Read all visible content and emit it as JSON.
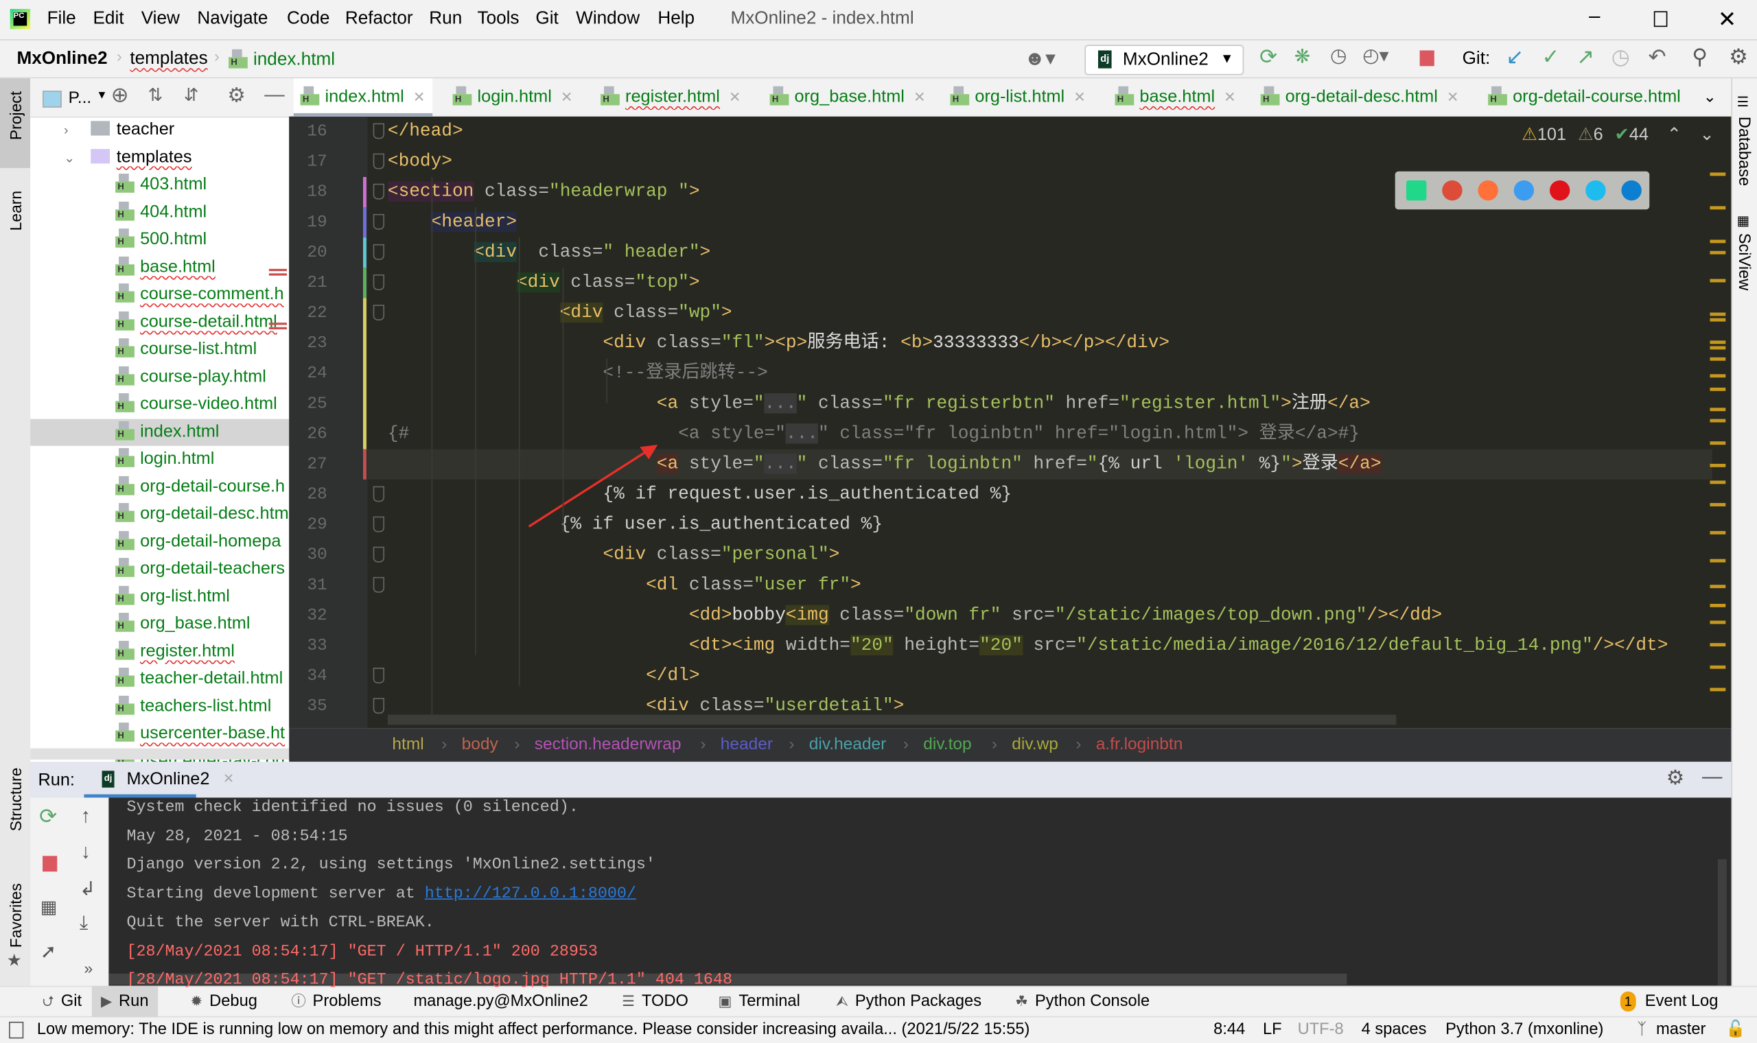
{
  "window": {
    "title": "MxOnline2 - index.html",
    "menu": [
      "File",
      "Edit",
      "View",
      "Navigate",
      "Code",
      "Refactor",
      "Run",
      "Tools",
      "Git",
      "Window",
      "Help"
    ],
    "controls": [
      "minimize",
      "restore",
      "close"
    ]
  },
  "navbar": {
    "breadcrumb": [
      "MxOnline2",
      "templates",
      "index.html"
    ],
    "run_config": "MxOnline2",
    "git_label": "Git:",
    "colors": {
      "stop": "#db5860",
      "run": "#59a869",
      "git_update": "#3592c4"
    }
  },
  "project_panel": {
    "title": "P...",
    "tree": [
      {
        "label": "teacher",
        "type": "folder",
        "expanded": false
      },
      {
        "label": "templates",
        "type": "folder",
        "expanded": true,
        "error": true
      },
      {
        "label": "403.html",
        "type": "file"
      },
      {
        "label": "404.html",
        "type": "file"
      },
      {
        "label": "500.html",
        "type": "file"
      },
      {
        "label": "base.html",
        "type": "file",
        "error": true
      },
      {
        "label": "course-comment.h",
        "type": "file",
        "error": true
      },
      {
        "label": "course-detail.html",
        "type": "file",
        "error": true
      },
      {
        "label": "course-list.html",
        "type": "file"
      },
      {
        "label": "course-play.html",
        "type": "file"
      },
      {
        "label": "course-video.html",
        "type": "file"
      },
      {
        "label": "index.html",
        "type": "file",
        "selected": true
      },
      {
        "label": "login.html",
        "type": "file"
      },
      {
        "label": "org-detail-course.h",
        "type": "file"
      },
      {
        "label": "org-detail-desc.htm",
        "type": "file"
      },
      {
        "label": "org-detail-homepa",
        "type": "file"
      },
      {
        "label": "org-detail-teachers",
        "type": "file"
      },
      {
        "label": "org-list.html",
        "type": "file"
      },
      {
        "label": "org_base.html",
        "type": "file"
      },
      {
        "label": "register.html",
        "type": "file",
        "error": true
      },
      {
        "label": "teacher-detail.html",
        "type": "file"
      },
      {
        "label": "teachers-list.html",
        "type": "file"
      },
      {
        "label": "usercenter-base.ht",
        "type": "file",
        "error": true
      },
      {
        "label": "usercenter-fav-cou",
        "type": "file"
      }
    ]
  },
  "side_left": [
    "Project",
    "Learn",
    "Structure",
    "Favorites"
  ],
  "side_right": [
    "Database",
    "SciView"
  ],
  "editor_tabs": [
    {
      "label": "index.html",
      "active": true
    },
    {
      "label": "login.html"
    },
    {
      "label": "register.html",
      "error": true
    },
    {
      "label": "org_base.html"
    },
    {
      "label": "org-list.html"
    },
    {
      "label": "base.html",
      "error": true
    },
    {
      "label": "org-detail-desc.html"
    },
    {
      "label": "org-detail-course.html"
    }
  ],
  "inspections": {
    "warnings": "101",
    "weak_warnings": "6",
    "typos": "44"
  },
  "browsers": [
    "pycharm",
    "chrome",
    "firefox",
    "safari",
    "opera",
    "internet-explorer",
    "edge"
  ],
  "code": [
    {
      "n": "16",
      "tokens": [
        [
          "</head>",
          "tag"
        ]
      ]
    },
    {
      "n": "17",
      "tokens": [
        [
          "<body>",
          "tag"
        ]
      ]
    },
    {
      "n": "18",
      "tokens": [
        [
          "<section",
          "tag",
          "#3c2438"
        ],
        [
          " class=",
          "attr"
        ],
        [
          "\"headerwrap \"",
          "val"
        ],
        [
          ">",
          "tag"
        ]
      ]
    },
    {
      "n": "19",
      "tokens": [
        [
          "    ",
          "txt"
        ],
        [
          "<header>",
          "tag",
          "#262a40"
        ]
      ]
    },
    {
      "n": "20",
      "tokens": [
        [
          "        ",
          "txt"
        ],
        [
          "<div",
          "tag",
          "#1f3b35"
        ],
        [
          "  class=",
          "attr"
        ],
        [
          "\" header\"",
          "val"
        ],
        [
          ">",
          "tag"
        ]
      ]
    },
    {
      "n": "21",
      "tokens": [
        [
          "            ",
          "txt"
        ],
        [
          "<div",
          "tag",
          "#1f3a1f"
        ],
        [
          " class=",
          "attr"
        ],
        [
          "\"top\"",
          "val"
        ],
        [
          ">",
          "tag"
        ]
      ]
    },
    {
      "n": "22",
      "tokens": [
        [
          "                ",
          "txt"
        ],
        [
          "<div",
          "tag",
          "#3a3a1c"
        ],
        [
          " class=",
          "attr"
        ],
        [
          "\"wp\"",
          "val"
        ],
        [
          ">",
          "tag"
        ]
      ]
    },
    {
      "n": "23",
      "tokens": [
        [
          "                    ",
          "txt"
        ],
        [
          "<div",
          "tag"
        ],
        [
          " class=",
          "attr"
        ],
        [
          "\"fl\"",
          "val"
        ],
        [
          "><p>",
          "tag"
        ],
        [
          "服务电话: ",
          "txt"
        ],
        [
          "<b>",
          "tag"
        ],
        [
          "33333333",
          "txt"
        ],
        [
          "</b></p></div>",
          "tag"
        ]
      ]
    },
    {
      "n": "24",
      "tokens": [
        [
          "                    ",
          "txt"
        ],
        [
          "<!--登录后跳转-->",
          "cmt"
        ]
      ]
    },
    {
      "n": "25",
      "tokens": [
        [
          "                         ",
          "txt"
        ],
        [
          "<a",
          "tag"
        ],
        [
          " style=",
          "attr"
        ],
        [
          "\"",
          "val"
        ],
        [
          "...",
          "cmt",
          "#3a3a3a"
        ],
        [
          "\"",
          "val"
        ],
        [
          " class=",
          "attr"
        ],
        [
          "\"fr registerbtn\"",
          "val"
        ],
        [
          " href=",
          "attr"
        ],
        [
          "\"register.html\"",
          "val"
        ],
        [
          ">",
          "tag"
        ],
        [
          "注册",
          "txt"
        ],
        [
          "</a>",
          "tag"
        ]
      ]
    },
    {
      "n": "26",
      "tokens": [
        [
          "{#                         <a style=\"",
          "cmt"
        ],
        [
          "...",
          "cmt",
          "#3a3a3a"
        ],
        [
          "\" class=\"fr loginbtn\" href=\"login.html\"> 登录</a>#}",
          "cmt"
        ]
      ]
    },
    {
      "n": "27",
      "current": true,
      "tokens": [
        [
          "                         ",
          "txt"
        ],
        [
          "<a",
          "tag",
          "#4a2a25"
        ],
        [
          " style=",
          "attr"
        ],
        [
          "\"",
          "val"
        ],
        [
          "...",
          "cmt",
          "#3a3a3a"
        ],
        [
          "\"",
          "val"
        ],
        [
          " class=",
          "attr"
        ],
        [
          "\"fr loginbtn\"",
          "val"
        ],
        [
          " href=",
          "attr"
        ],
        [
          "\"",
          "val"
        ],
        [
          "{% url ",
          "tpl"
        ],
        [
          "'login'",
          "val"
        ],
        [
          " %}",
          "tpl"
        ],
        [
          "\"",
          "val"
        ],
        [
          ">",
          "tag"
        ],
        [
          "登录",
          "txt"
        ],
        [
          "</a>",
          "tag",
          "#4a2a25"
        ]
      ]
    },
    {
      "n": "28",
      "tokens": [
        [
          "                    ",
          "txt"
        ],
        [
          "{% if request.user.is_authenticated %}",
          "tpl"
        ]
      ]
    },
    {
      "n": "29",
      "tokens": [
        [
          "                ",
          "txt"
        ],
        [
          "{% if user.is_authenticated %}",
          "tpl"
        ]
      ]
    },
    {
      "n": "30",
      "tokens": [
        [
          "                    ",
          "txt"
        ],
        [
          "<div",
          "tag"
        ],
        [
          " class=",
          "attr"
        ],
        [
          "\"personal\"",
          "val"
        ],
        [
          ">",
          "tag"
        ]
      ]
    },
    {
      "n": "31",
      "tokens": [
        [
          "                        ",
          "txt"
        ],
        [
          "<dl",
          "tag"
        ],
        [
          " class=",
          "attr"
        ],
        [
          "\"user fr\"",
          "val"
        ],
        [
          ">",
          "tag"
        ]
      ]
    },
    {
      "n": "32",
      "tokens": [
        [
          "                            ",
          "txt"
        ],
        [
          "<dd>",
          "tag"
        ],
        [
          "bobby",
          "txt"
        ],
        [
          "<img",
          "tag",
          "#3a3a1c"
        ],
        [
          " class=",
          "attr"
        ],
        [
          "\"down fr\"",
          "val"
        ],
        [
          " src=",
          "attr"
        ],
        [
          "\"/static/images/top_down.png\"",
          "val"
        ],
        [
          "/></dd>",
          "tag"
        ]
      ]
    },
    {
      "n": "33",
      "tokens": [
        [
          "                            ",
          "txt"
        ],
        [
          "<dt><img",
          "tag"
        ],
        [
          " width=",
          "attr"
        ],
        [
          "\"20\"",
          "val",
          "#3a3a1c"
        ],
        [
          " height=",
          "attr"
        ],
        [
          "\"20\"",
          "val",
          "#3a3a1c"
        ],
        [
          " src=",
          "attr"
        ],
        [
          "\"/static/media/image/2016/12/default_big_14.png\"",
          "val"
        ],
        [
          "/></dt>",
          "tag"
        ]
      ]
    },
    {
      "n": "34",
      "tokens": [
        [
          "                        ",
          "txt"
        ],
        [
          "</dl>",
          "tag"
        ]
      ]
    },
    {
      "n": "35",
      "tokens": [
        [
          "                        ",
          "txt"
        ],
        [
          "<div",
          "tag"
        ],
        [
          " class=",
          "attr"
        ],
        [
          "\"userdetail\"",
          "val"
        ],
        [
          ">",
          "tag"
        ]
      ]
    }
  ],
  "editor_breadcrumb": [
    {
      "label": "html",
      "color": "#b8a84a"
    },
    {
      "label": "body",
      "color": "#c0644e"
    },
    {
      "label": "section.headerwrap",
      "color": "#b452b4"
    },
    {
      "label": "header",
      "color": "#5c5cc8"
    },
    {
      "label": "div.header",
      "color": "#4aa0a8"
    },
    {
      "label": "div.top",
      "color": "#52a852"
    },
    {
      "label": "div.wp",
      "color": "#a8a83a"
    },
    {
      "label": "a.fr.loginbtn",
      "color": "#c44c4c"
    }
  ],
  "run_panel": {
    "label": "Run:",
    "tab": "MxOnline2",
    "console": [
      {
        "text": "System check identified no issues (0 silenced).",
        "kind": "out"
      },
      {
        "text": "May 28, 2021 - 08:54:15",
        "kind": "out"
      },
      {
        "text": "Django version 2.2, using settings 'MxOnline2.settings'",
        "kind": "out"
      },
      {
        "text": "Starting development server at ",
        "kind": "out",
        "link": "http://127.0.0.1:8000/"
      },
      {
        "text": "Quit the server with CTRL-BREAK.",
        "kind": "out"
      },
      {
        "text": "[28/May/2021 08:54:17] \"GET / HTTP/1.1\" 200 28953",
        "kind": "err"
      },
      {
        "text": "[28/May/2021 08:54:17] \"GET /static/logo.jpg HTTP/1.1\" 404 1648",
        "kind": "err"
      }
    ]
  },
  "bottom_tools": [
    "Git",
    "Run",
    "Debug",
    "Problems",
    "manage.py@MxOnline2",
    "TODO",
    "Terminal",
    "Python Packages",
    "Python Console"
  ],
  "event_log": {
    "label": "Event Log",
    "count": "1"
  },
  "status": {
    "message": "Low memory: The IDE is running low on memory and this might affect performance. Please consider increasing availa... (2021/5/22 15:55)",
    "position": "8:44",
    "line_sep": "LF",
    "encoding": "UTF-8",
    "indent": "4 spaces",
    "interpreter": "Python 3.7 (mxonline)",
    "branch": "master"
  }
}
